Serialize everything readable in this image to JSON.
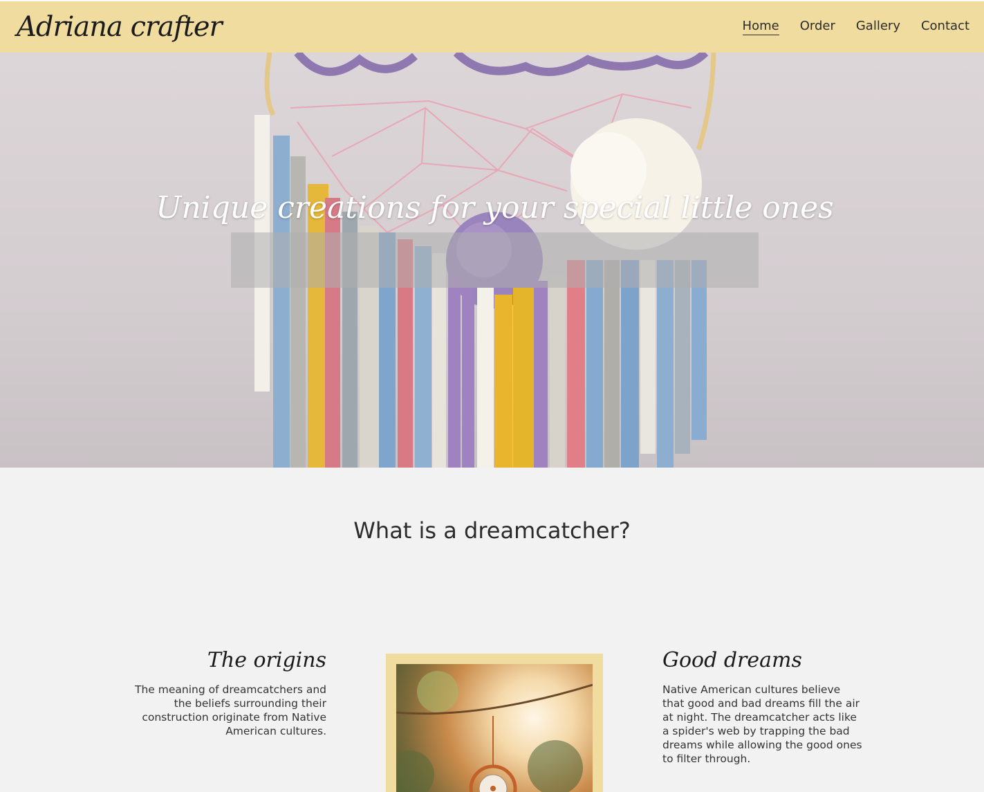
{
  "header": {
    "logo_text": "Adriana crafter",
    "nav": [
      {
        "label": "Home",
        "active": true
      },
      {
        "label": "Order",
        "active": false
      },
      {
        "label": "Gallery",
        "active": false
      },
      {
        "label": "Contact",
        "active": false
      }
    ]
  },
  "hero": {
    "caption": "Unique creations for your special little ones"
  },
  "section": {
    "title": "What is a dreamcatcher?",
    "left": {
      "heading": "The origins",
      "text": "The meaning of dreamcatchers and the beliefs surrounding their construction originate from Native American cultures."
    },
    "right": {
      "heading": "Good dreams",
      "text": "Native American cultures believe that good and bad dreams fill the air at night. The dreamcatcher acts like a spider's web by trapping the bad dreams while allowing the good ones to filter through."
    }
  },
  "colors": {
    "header_bg": "#f0dc9e",
    "page_bg": "#f2f2f2",
    "text": "#2b2b2b",
    "frame": "#f0dc9e"
  }
}
